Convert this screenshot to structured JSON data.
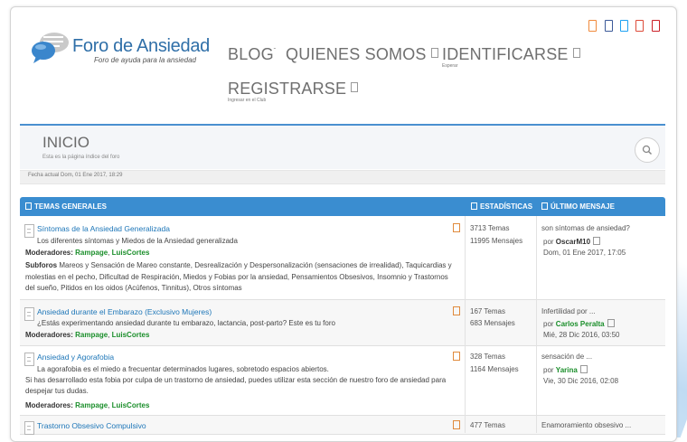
{
  "header": {
    "logo_title": "Foro de Ansiedad",
    "logo_subtitle": "Foro de ayuda para la ansiedad",
    "nav": [
      {
        "label": "BLOG",
        "sub": ""
      },
      {
        "label": "QUIENES SOMOS",
        "sub": ""
      },
      {
        "label": "IDENTIFICARSE",
        "sub": "Esperar"
      },
      {
        "label": "REGISTRARSE",
        "sub": "Ingresar en el Club"
      }
    ],
    "social_colors": [
      "#f08a3c",
      "#3b5998",
      "#1da1f2",
      "#dd4b39",
      "#cb2027"
    ]
  },
  "breadcrumb": {
    "title": "INICIO",
    "subtitle": "Esta es la página índice del foro"
  },
  "fecha_actual": "Fecha actual Dom, 01 Ene 2017, 18:29",
  "table": {
    "headers": {
      "forum": "TEMAS GENERALES",
      "stats": "ESTADÍSTICAS",
      "last": "ÚLTIMO MENSAJE"
    },
    "moderators_label": "Moderadores:",
    "subforums_label": "Subforos",
    "rows": [
      {
        "title": "Síntomas de la Ansiedad Generalizada",
        "description": "Los diferentes síntomas y Miedos de la Ansiedad generalizada",
        "moderators": [
          "Rampage",
          "LuisCortes"
        ],
        "subforums": "Mareos y Sensación de Mareo constante, Desrealización y Despersonalización (sensaciones de irrealidad), Taquicardias y molestias en el pecho, Dificultad de Respiración, Miedos y Fobias por la ansiedad, Pensamientos Obsesivos, Insomnio y Trastornos del sueño, Pitidos en los oidos (Acúfenos, Tinnitus), Otros síntomas",
        "topics": "3713 Temas",
        "posts": "11995 Mensajes",
        "last_title": "son síntomas de ansiedad?",
        "last_by": "por",
        "last_user": "OscarM10",
        "last_user_green": false,
        "last_date": "Dom, 01 Ene 2017, 17:05"
      },
      {
        "title": "Ansiedad durante el Embarazo (Exclusivo Mujeres)",
        "description": "¿Estás experimentando ansiedad durante tu embarazo, lactancia, post-parto? Este es tu foro",
        "moderators": [
          "Rampage",
          "LuisCortes"
        ],
        "topics": "167 Temas",
        "posts": "683 Mensajes",
        "last_title": "Infertilidad por ...",
        "last_by": "por",
        "last_user": "Carlos Peralta",
        "last_user_green": true,
        "last_date": "Mié, 28 Dic 2016, 03:50"
      },
      {
        "title": "Ansiedad y Agorafobia",
        "description": "La agorafobia es el miedo a frecuentar determinados lugares, sobretodo espacios abiertos.",
        "description2": "Si has desarrollado esta fobia por culpa de un trastorno de ansiedad, puedes utilizar esta sección de nuestro foro de ansiedad para despejar tus dudas.",
        "moderators": [
          "Rampage",
          "LuisCortes"
        ],
        "topics": "328 Temas",
        "posts": "1164 Mensajes",
        "last_title": "sensación de ...",
        "last_by": "por",
        "last_user": "Yarina",
        "last_user_green": true,
        "last_date": "Vie, 30 Dic 2016, 02:08"
      },
      {
        "title": "Trastorno Obsesivo Compulsivo",
        "topics": "477 Temas",
        "last_title": "Enamoramiento obsesivo ..."
      }
    ]
  }
}
